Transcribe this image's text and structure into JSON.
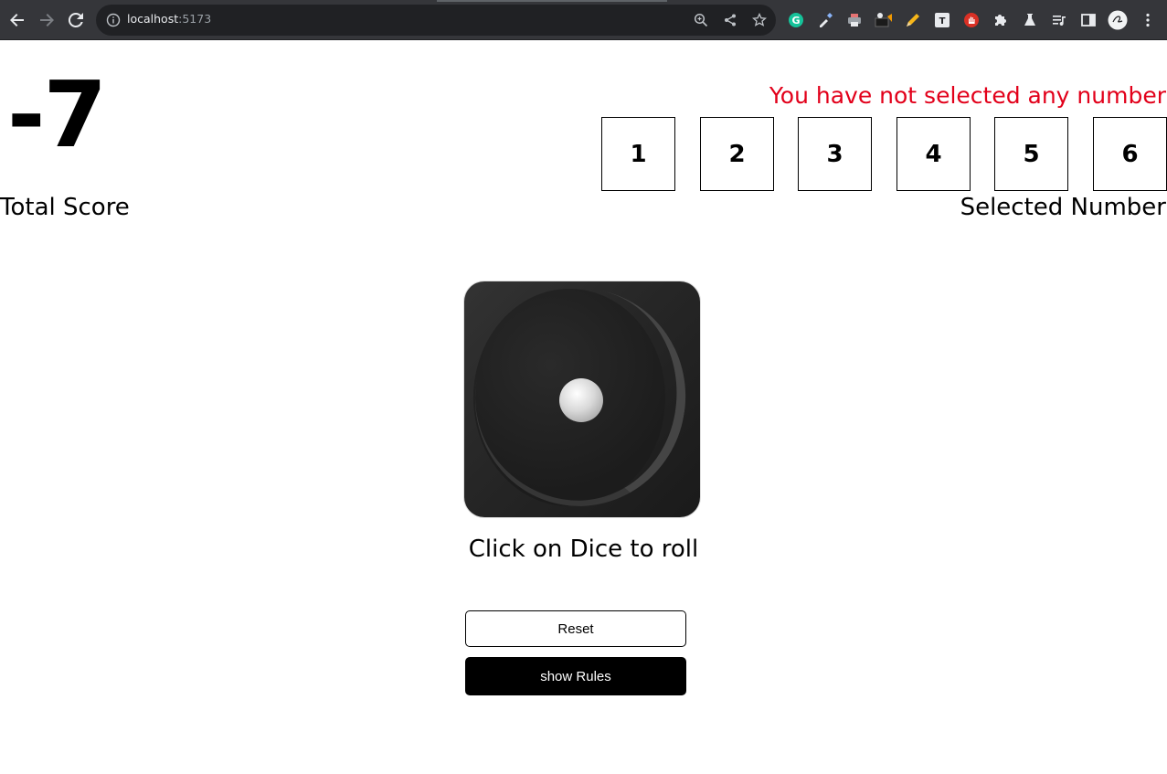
{
  "browser": {
    "url_host": "localhost",
    "url_port": ":5173",
    "toolbar_icons": [
      "back-icon",
      "forward-icon",
      "reload-icon",
      "info-icon",
      "zoom-icon",
      "share-icon",
      "bookmark-star-icon"
    ],
    "extensions": [
      "grammarly-icon",
      "color-picker-icon",
      "printer-icon",
      "dark-reader-icon",
      "pencil-icon",
      "text-icon",
      "hand-stop-icon",
      "puzzle-icon",
      "flask-icon",
      "media-queue-icon",
      "side-panel-icon",
      "profile-avatar",
      "menu-icon"
    ]
  },
  "score": {
    "value": "-7",
    "label": "Total Score"
  },
  "selector": {
    "error": "You have not selected any number",
    "numbers": [
      "1",
      "2",
      "3",
      "4",
      "5",
      "6"
    ],
    "label": "Selected Number"
  },
  "dice": {
    "face_value": 1,
    "hint": "Click on Dice to roll"
  },
  "buttons": {
    "reset": "Reset",
    "rules": "show Rules"
  },
  "colors": {
    "error": "#e2001a",
    "primary": "#000000",
    "chrome_bg": "#35363a"
  }
}
